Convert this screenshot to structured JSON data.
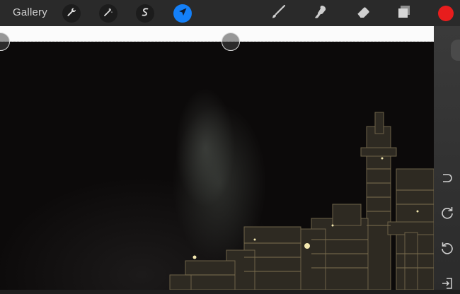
{
  "toolbar": {
    "gallery_label": "Gallery",
    "tools_left": [
      {
        "name": "adjustments",
        "icon": "wrench-icon"
      },
      {
        "name": "magic",
        "icon": "magic-wand-icon"
      },
      {
        "name": "selection",
        "icon": "s-curve-icon"
      },
      {
        "name": "transform",
        "icon": "arrow-cursor-icon",
        "active": true
      }
    ],
    "tools_right": [
      {
        "name": "brush",
        "icon": "brush-icon"
      },
      {
        "name": "smudge",
        "icon": "smudge-icon"
      },
      {
        "name": "eraser",
        "icon": "eraser-icon"
      },
      {
        "name": "layers",
        "icon": "layers-icon"
      }
    ],
    "current_color": "#e81d1d",
    "active_color": "#1480f8"
  },
  "sidebar": {
    "buttons": [
      {
        "name": "magnet",
        "icon": "magnet-icon"
      },
      {
        "name": "redo",
        "icon": "redo-icon"
      },
      {
        "name": "undo",
        "icon": "undo-icon"
      },
      {
        "name": "exit",
        "icon": "exit-icon"
      }
    ]
  }
}
